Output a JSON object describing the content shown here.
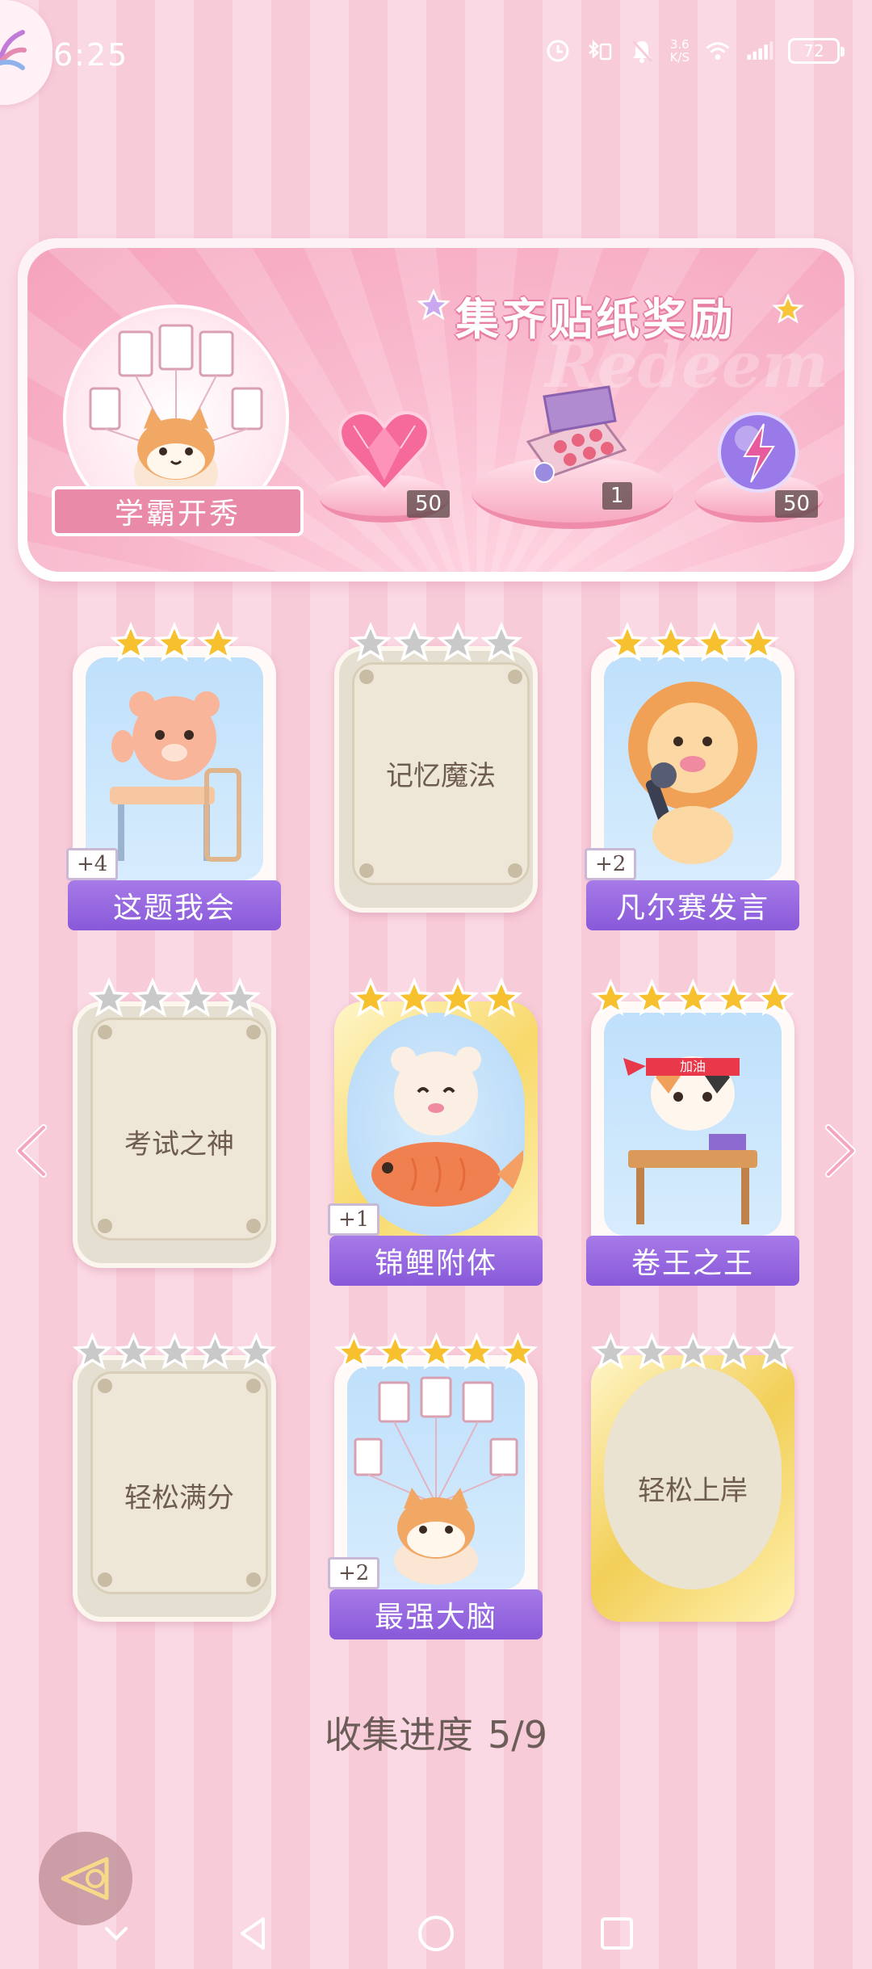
{
  "status_bar": {
    "time": "6:25",
    "net_speed_value": "3.6",
    "net_speed_unit": "K/S",
    "battery": "72"
  },
  "banner": {
    "title": "集齐贴纸奖励",
    "watermark": "Redeem",
    "avatar_ribbon": "学霸开秀",
    "rewards": [
      {
        "name": "heart-gem",
        "count": "50"
      },
      {
        "name": "sticker-box",
        "count": "1"
      },
      {
        "name": "energy-orb",
        "count": "50"
      }
    ]
  },
  "stickers": [
    {
      "title": "这题我会",
      "stars": 3,
      "max_stars": 3,
      "bonus": "+4",
      "state": "unlocked",
      "art": "bear-at-desk"
    },
    {
      "title": "记忆魔法",
      "stars": 0,
      "max_stars": 4,
      "bonus": "",
      "state": "locked",
      "art": ""
    },
    {
      "title": "凡尔赛发言",
      "stars": 4,
      "max_stars": 4,
      "bonus": "+2",
      "state": "unlocked",
      "art": "lion-with-mic"
    },
    {
      "title": "考试之神",
      "stars": 0,
      "max_stars": 4,
      "bonus": "",
      "state": "locked",
      "art": ""
    },
    {
      "title": "锦鲤附体",
      "stars": 4,
      "max_stars": 4,
      "bonus": "+1",
      "state": "unlocked-gold",
      "art": "bear-with-koi"
    },
    {
      "title": "卷王之王",
      "stars": 5,
      "max_stars": 5,
      "bonus": "",
      "state": "unlocked",
      "art": "cat-studying",
      "headband": "加油"
    },
    {
      "title": "轻松满分",
      "stars": 0,
      "max_stars": 5,
      "bonus": "",
      "state": "locked",
      "art": ""
    },
    {
      "title": "最强大脑",
      "stars": 5,
      "max_stars": 5,
      "bonus": "+2",
      "state": "unlocked",
      "art": "cat-with-papers"
    },
    {
      "title": "轻松上岸",
      "stars": 0,
      "max_stars": 5,
      "bonus": "",
      "state": "locked-gold",
      "art": ""
    }
  ],
  "progress": {
    "label": "收集进度",
    "value": "5/9"
  },
  "colors": {
    "accent_purple": "#8859d9",
    "banner_pink": "#f5a3bc",
    "star_gold": "#f6c02e",
    "star_gray": "#c9c9c9"
  }
}
